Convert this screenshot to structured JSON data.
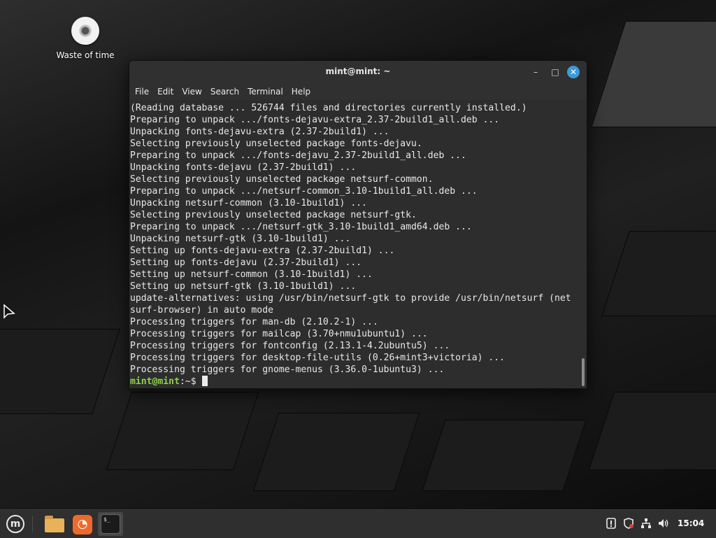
{
  "desktop": {
    "icon_label": "Waste of time"
  },
  "window": {
    "title": "mint@mint: ~",
    "controls": {
      "minimize": "–",
      "maximize": "□",
      "close": "✕"
    },
    "menu": [
      "File",
      "Edit",
      "View",
      "Search",
      "Terminal",
      "Help"
    ]
  },
  "terminal": {
    "lines": [
      "(Reading database ... 526744 files and directories currently installed.)",
      "Preparing to unpack .../fonts-dejavu-extra_2.37-2build1_all.deb ...",
      "Unpacking fonts-dejavu-extra (2.37-2build1) ...",
      "Selecting previously unselected package fonts-dejavu.",
      "Preparing to unpack .../fonts-dejavu_2.37-2build1_all.deb ...",
      "Unpacking fonts-dejavu (2.37-2build1) ...",
      "Selecting previously unselected package netsurf-common.",
      "Preparing to unpack .../netsurf-common_3.10-1build1_all.deb ...",
      "Unpacking netsurf-common (3.10-1build1) ...",
      "Selecting previously unselected package netsurf-gtk.",
      "Preparing to unpack .../netsurf-gtk_3.10-1build1_amd64.deb ...",
      "Unpacking netsurf-gtk (3.10-1build1) ...",
      "Setting up fonts-dejavu-extra (2.37-2build1) ...",
      "Setting up fonts-dejavu (2.37-2build1) ...",
      "Setting up netsurf-common (3.10-1build1) ...",
      "Setting up netsurf-gtk (3.10-1build1) ...",
      "update-alternatives: using /usr/bin/netsurf-gtk to provide /usr/bin/netsurf (net",
      "surf-browser) in auto mode",
      "Processing triggers for man-db (2.10.2-1) ...",
      "Processing triggers for mailcap (3.70+nmu1ubuntu1) ...",
      "Processing triggers for fontconfig (2.13.1-4.2ubuntu5) ...",
      "Processing triggers for desktop-file-utils (0.26+mint3+victoria) ...",
      "Processing triggers for gnome-menus (3.36.0-1ubuntu3) ..."
    ],
    "prompt": {
      "user_host": "mint@mint",
      "path": ":~$ "
    },
    "colors": {
      "prompt": "#8ed14b",
      "background": "#2d2d2d",
      "text": "#e8e8e8"
    }
  },
  "panel": {
    "menu_icon": "mint-logo-icon",
    "launchers": [
      "files-folder-icon",
      "firefox-icon",
      "terminal-icon"
    ],
    "terminal_icon_text": "$_",
    "tray": [
      "update-manager-icon",
      "shield-icon",
      "network-icon",
      "volume-icon"
    ],
    "clock": "15:04"
  }
}
